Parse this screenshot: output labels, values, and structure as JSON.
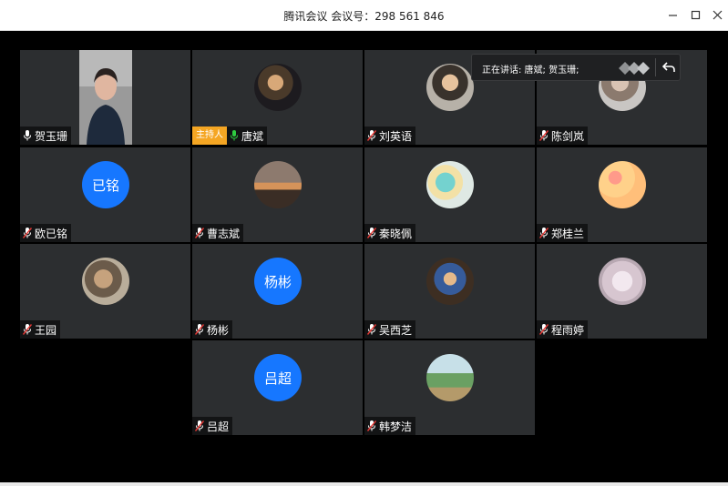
{
  "window": {
    "title": "腾讯会议 会议号：298 561 846",
    "minimize_icon": "minimize-icon",
    "maximize_icon": "maximize-icon",
    "close_icon": "close-icon"
  },
  "speaking_banner": {
    "text": "正在讲话: 唐斌; 贺玉珊;",
    "collapse_icon": "return-arrow-icon"
  },
  "host_badge": "主持人",
  "colors": {
    "avatar_blue": "#1677ff",
    "host_badge": "#f5a623",
    "mic_active": "#2ecc40",
    "mic_muted": "#e53935",
    "tile_bg": "#2c2e30"
  },
  "participants": [
    {
      "name": "贺玉珊",
      "kind": "video",
      "mic": "on",
      "host": false
    },
    {
      "name": "唐斌",
      "kind": "photo",
      "mic": "active",
      "host": true
    },
    {
      "name": "刘英语",
      "kind": "photo",
      "mic": "muted",
      "host": false
    },
    {
      "name": "陈剑岚",
      "kind": "photo",
      "mic": "muted",
      "host": false
    },
    {
      "name": "欧已铭",
      "kind": "text",
      "avatar_text": "已铭",
      "mic": "muted",
      "host": false
    },
    {
      "name": "曹志斌",
      "kind": "photo",
      "mic": "muted",
      "host": false
    },
    {
      "name": "秦晓佩",
      "kind": "photo",
      "mic": "muted",
      "host": false
    },
    {
      "name": "郑桂兰",
      "kind": "photo",
      "mic": "muted",
      "host": false
    },
    {
      "name": "王园",
      "kind": "photo",
      "mic": "muted",
      "host": false
    },
    {
      "name": "杨彬",
      "kind": "text",
      "avatar_text": "杨彬",
      "mic": "muted",
      "host": false
    },
    {
      "name": "吴西芝",
      "kind": "photo",
      "mic": "muted",
      "host": false
    },
    {
      "name": "程雨婷",
      "kind": "photo",
      "mic": "muted",
      "host": false
    },
    {
      "name": "吕超",
      "kind": "text",
      "avatar_text": "吕超",
      "mic": "muted",
      "host": false
    },
    {
      "name": "韩梦洁",
      "kind": "photo",
      "mic": "muted",
      "host": false
    }
  ]
}
